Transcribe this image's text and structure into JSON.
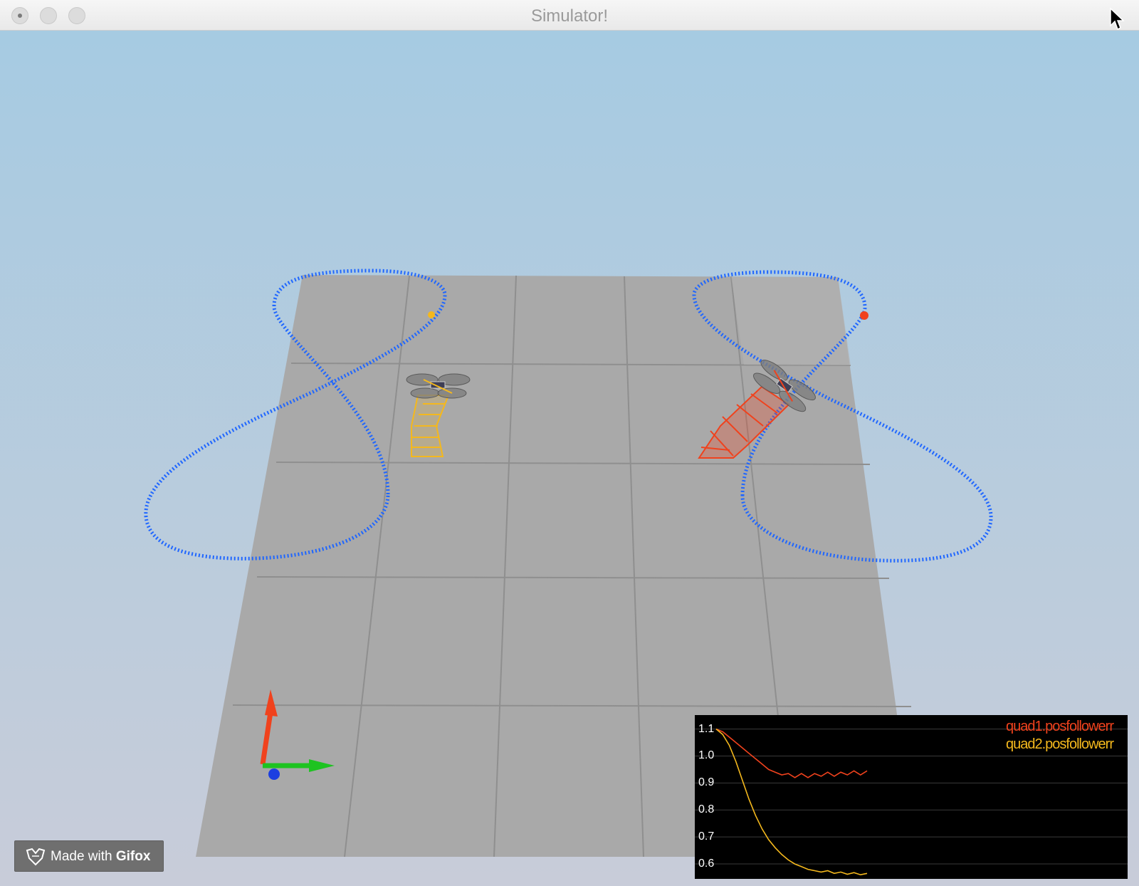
{
  "window": {
    "title": "Simulator!"
  },
  "colors": {
    "sky_top": "#a6cbe2",
    "sky_bottom": "#c8ccd9",
    "floor": "#a9a9a9",
    "trajectory": "#1f66ff",
    "quad1": "#f0421d",
    "quad2": "#f4b81d"
  },
  "icons": {
    "close": "close-button",
    "minimize": "minimize-button",
    "zoom": "zoom-button",
    "cursor": "cursor-icon",
    "axes": "axes-gizmo-icon",
    "drone": "quadrotor-icon",
    "fox": "gifox-fox-icon"
  },
  "watermark": {
    "prefix": "Made with ",
    "brand": "Gifox"
  },
  "chart_data": {
    "type": "line",
    "yticks": [
      "1.1",
      "1.0",
      "0.9",
      "0.8",
      "0.7",
      "0.6"
    ],
    "ylim": [
      0.55,
      1.12
    ],
    "grid": true,
    "legend": "top-right",
    "series": [
      {
        "name": "quad1.posfollowerr",
        "color": "#f0421d",
        "values": [
          1.1,
          1.09,
          1.07,
          1.05,
          1.03,
          1.01,
          0.99,
          0.97,
          0.95,
          0.94,
          0.93,
          0.935,
          0.92,
          0.935,
          0.92,
          0.935,
          0.925,
          0.94,
          0.925,
          0.94,
          0.93,
          0.945,
          0.93,
          0.945
        ]
      },
      {
        "name": "quad2.posfollowerr",
        "color": "#f4b81d",
        "values": [
          1.1,
          1.08,
          1.04,
          0.98,
          0.91,
          0.84,
          0.78,
          0.73,
          0.69,
          0.66,
          0.635,
          0.615,
          0.6,
          0.59,
          0.58,
          0.575,
          0.57,
          0.575,
          0.565,
          0.57,
          0.562,
          0.568,
          0.56,
          0.565
        ]
      }
    ]
  }
}
